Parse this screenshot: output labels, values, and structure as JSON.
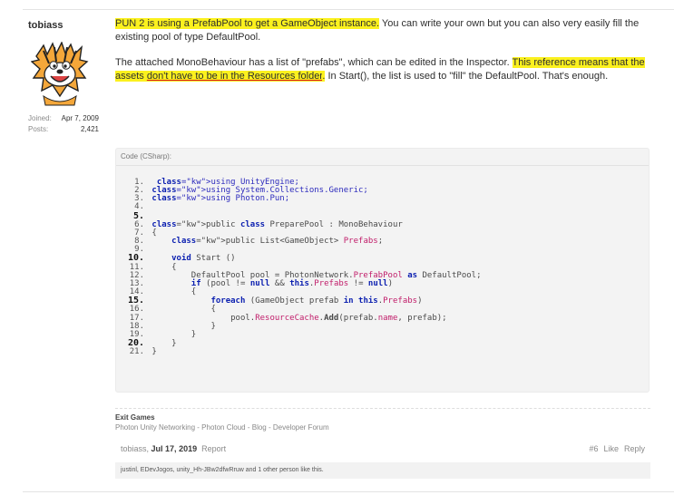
{
  "user": {
    "name": "tobiass",
    "joined_label": "Joined:",
    "joined_value": "Apr 7, 2009",
    "posts_label": "Posts:",
    "posts_value": "2,421"
  },
  "post": {
    "p1_a": "PUN 2 is using a PrefabPool to get a GameObject instance.",
    "p1_b": " You can write your own but you can also very easily fill the existing pool of type DefaultPool.",
    "p2_a": "The attached MonoBehaviour has a list of \"prefabs\", which can be edited in the Inspector. ",
    "p2_b": "This reference means that the assets ",
    "p2_c": "don't have to be in the Resources folder",
    "p2_d": ".",
    "p2_e": " In Start(), the list is used to \"fill\" the DefaultPool. That's enough."
  },
  "code": {
    "header": "Code (CSharp):",
    "lines": [
      "using UnityEngine;",
      "using System.Collections.Generic;",
      "using Photon.Pun;",
      "",
      "",
      "public class PreparePool : MonoBehaviour",
      "{",
      "    public List<GameObject> Prefabs;",
      "",
      "    void Start ()",
      "    {",
      "        DefaultPool pool = PhotonNetwork.PrefabPool as DefaultPool;",
      "        if (pool != null && this.Prefabs != null)",
      "        {",
      "            foreach (GameObject prefab in this.Prefabs)",
      "            {",
      "                pool.ResourceCache.Add(prefab.name, prefab);",
      "            }",
      "        }",
      "    }",
      "}"
    ]
  },
  "signature": {
    "title": "Exit Games",
    "links": "Photon Unity Networking - Photon Cloud - Blog - Developer Forum"
  },
  "footer": {
    "author": "tobiass",
    "date": "Jul 17, 2019",
    "report": "Report",
    "post_number": "#6",
    "like": "Like",
    "reply": "Reply"
  },
  "likes_text": "justinl, EDevJogos, unity_Hh-JBw2dfwRruw and 1 other person like this."
}
